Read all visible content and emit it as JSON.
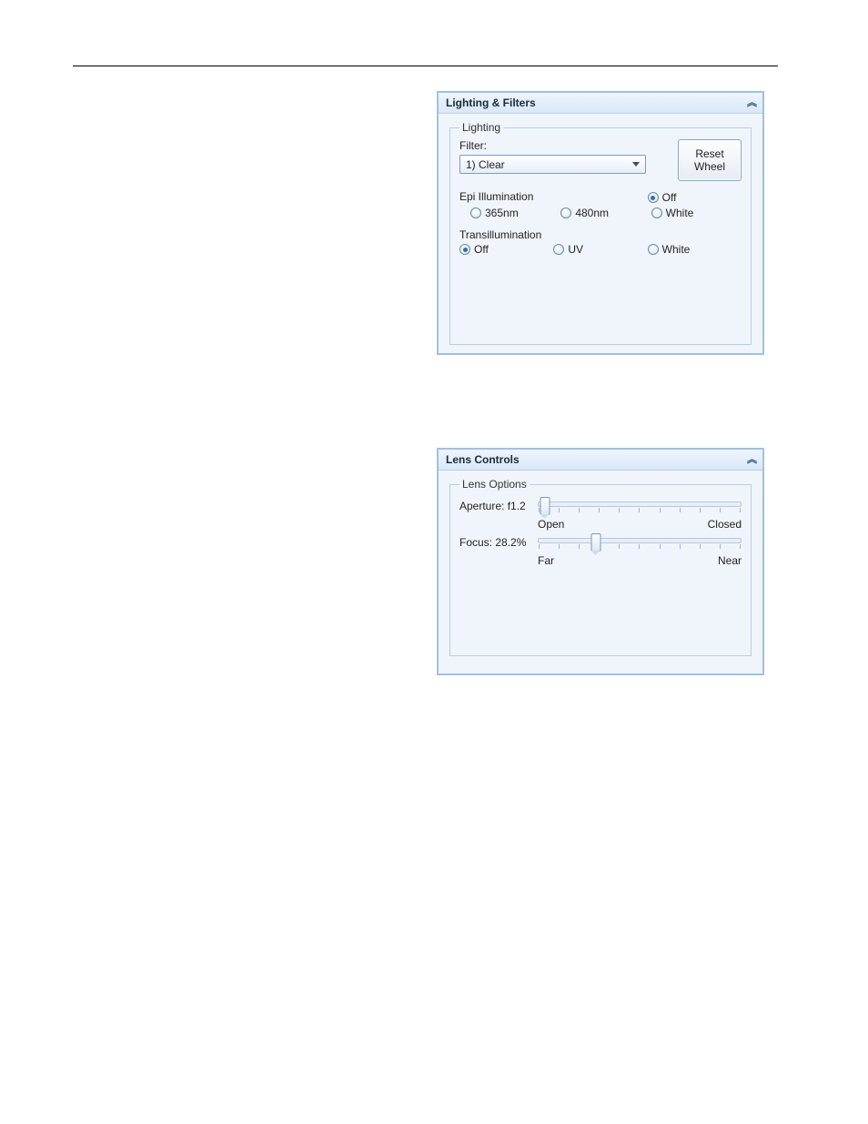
{
  "panel1": {
    "title": "Lighting & Filters",
    "group_legend": "Lighting",
    "filter_label": "Filter:",
    "filter_selected": "1) Clear",
    "reset_btn": "Reset\nWheel",
    "epi": {
      "heading": "Epi Illumination",
      "options": [
        {
          "label": "365nm",
          "checked": false
        },
        {
          "label": "480nm",
          "checked": false
        }
      ],
      "side": {
        "label": "Off",
        "checked": true
      }
    },
    "epi_white": {
      "label": "White",
      "checked": false
    },
    "trans": {
      "heading": "Transillumination",
      "options": [
        {
          "label": "Off",
          "checked": true
        },
        {
          "label": "UV",
          "checked": false
        },
        {
          "label": "White",
          "checked": false
        }
      ]
    }
  },
  "panel2": {
    "title": "Lens Controls",
    "group_legend": "Lens Options",
    "aperture": {
      "label": "Aperture: f1.2",
      "left": "Open",
      "right": "Closed",
      "pos_percent": 3
    },
    "focus": {
      "label": "Focus: 28.2%",
      "left": "Far",
      "right": "Near",
      "pos_percent": 28.2
    }
  }
}
